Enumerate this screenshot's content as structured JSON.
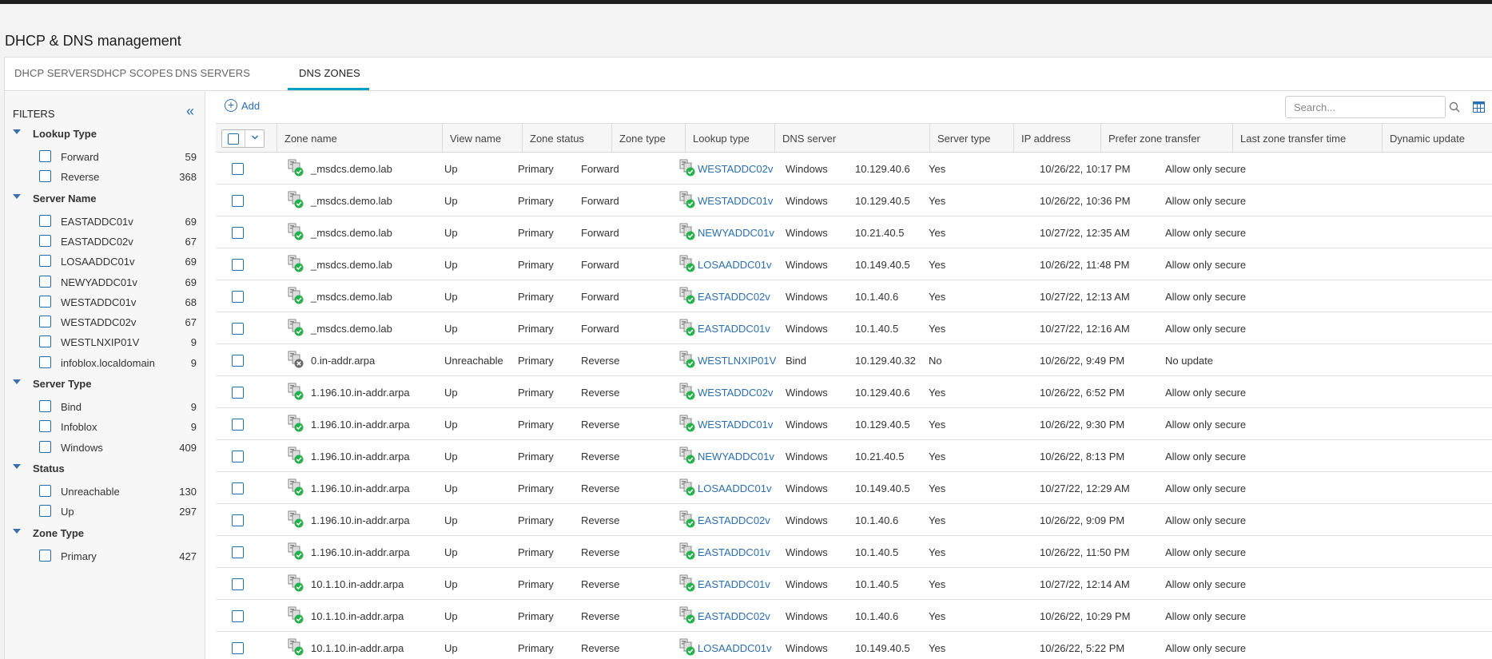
{
  "page": {
    "title": "DHCP & DNS management"
  },
  "tabs": [
    {
      "label": "DHCP SERVERS"
    },
    {
      "label": "DHCP SCOPES"
    },
    {
      "label": "DNS SERVERS"
    },
    {
      "label": "DNS ZONES",
      "active": true
    }
  ],
  "filters": {
    "title": "FILTERS",
    "groups": [
      {
        "label": "Lookup Type",
        "items": [
          {
            "label": "Forward",
            "count": "59"
          },
          {
            "label": "Reverse",
            "count": "368"
          }
        ]
      },
      {
        "label": "Server Name",
        "items": [
          {
            "label": "EASTADDC01v",
            "count": "69"
          },
          {
            "label": "EASTADDC02v",
            "count": "67"
          },
          {
            "label": "LOSAADDC01v",
            "count": "69"
          },
          {
            "label": "NEWYADDC01v",
            "count": "69"
          },
          {
            "label": "WESTADDC01v",
            "count": "68"
          },
          {
            "label": "WESTADDC02v",
            "count": "67"
          },
          {
            "label": "WESTLNXIP01V",
            "count": "9"
          },
          {
            "label": "infoblox.localdomain",
            "count": "9"
          }
        ]
      },
      {
        "label": "Server Type",
        "items": [
          {
            "label": "Bind",
            "count": "9"
          },
          {
            "label": "Infoblox",
            "count": "9"
          },
          {
            "label": "Windows",
            "count": "409"
          }
        ]
      },
      {
        "label": "Status",
        "items": [
          {
            "label": "Unreachable",
            "count": "130"
          },
          {
            "label": "Up",
            "count": "297"
          }
        ]
      },
      {
        "label": "Zone Type",
        "items": [
          {
            "label": "Primary",
            "count": "427"
          }
        ]
      }
    ]
  },
  "toolbar": {
    "add_label": "Add",
    "search_placeholder": "Search..."
  },
  "grid": {
    "columns": [
      {
        "label": "Zone name"
      },
      {
        "label": "View name"
      },
      {
        "label": "Zone status"
      },
      {
        "label": "Zone type"
      },
      {
        "label": "Lookup type"
      },
      {
        "label": "DNS server"
      },
      {
        "label": "Server type"
      },
      {
        "label": "IP address"
      },
      {
        "label": "Prefer zone transfer"
      },
      {
        "label": "Last zone transfer time"
      },
      {
        "label": "Dynamic update"
      }
    ],
    "rows": [
      {
        "zone": "_msdcs.demo.lab",
        "zone_state": "ok",
        "view": "",
        "status": "Up",
        "ztype": "Primary",
        "lookup": "Forward",
        "server": "WESTADDC02v",
        "stype": "Windows",
        "ip": "10.129.40.6",
        "prefer": "Yes",
        "last": "10/26/22, 10:17 PM",
        "dyn": "Allow only secure"
      },
      {
        "zone": "_msdcs.demo.lab",
        "zone_state": "ok",
        "view": "",
        "status": "Up",
        "ztype": "Primary",
        "lookup": "Forward",
        "server": "WESTADDC01v",
        "stype": "Windows",
        "ip": "10.129.40.5",
        "prefer": "Yes",
        "last": "10/26/22, 10:36 PM",
        "dyn": "Allow only secure"
      },
      {
        "zone": "_msdcs.demo.lab",
        "zone_state": "ok",
        "view": "",
        "status": "Up",
        "ztype": "Primary",
        "lookup": "Forward",
        "server": "NEWYADDC01v",
        "stype": "Windows",
        "ip": "10.21.40.5",
        "prefer": "Yes",
        "last": "10/27/22, 12:35 AM",
        "dyn": "Allow only secure"
      },
      {
        "zone": "_msdcs.demo.lab",
        "zone_state": "ok",
        "view": "",
        "status": "Up",
        "ztype": "Primary",
        "lookup": "Forward",
        "server": "LOSAADDC01v",
        "stype": "Windows",
        "ip": "10.149.40.5",
        "prefer": "Yes",
        "last": "10/26/22, 11:48 PM",
        "dyn": "Allow only secure"
      },
      {
        "zone": "_msdcs.demo.lab",
        "zone_state": "ok",
        "view": "",
        "status": "Up",
        "ztype": "Primary",
        "lookup": "Forward",
        "server": "EASTADDC02v",
        "stype": "Windows",
        "ip": "10.1.40.6",
        "prefer": "Yes",
        "last": "10/27/22, 12:13 AM",
        "dyn": "Allow only secure"
      },
      {
        "zone": "_msdcs.demo.lab",
        "zone_state": "ok",
        "view": "",
        "status": "Up",
        "ztype": "Primary",
        "lookup": "Forward",
        "server": "EASTADDC01v",
        "stype": "Windows",
        "ip": "10.1.40.5",
        "prefer": "Yes",
        "last": "10/27/22, 12:16 AM",
        "dyn": "Allow only secure"
      },
      {
        "zone": "0.in-addr.arpa",
        "zone_state": "unreachable",
        "view": "",
        "status": "Unreachable",
        "ztype": "Primary",
        "lookup": "Reverse",
        "server": "WESTLNXIP01V",
        "stype": "Bind",
        "ip": "10.129.40.32",
        "prefer": "No",
        "last": "10/26/22, 9:49 PM",
        "dyn": "No update"
      },
      {
        "zone": "1.196.10.in-addr.arpa",
        "zone_state": "ok",
        "view": "",
        "status": "Up",
        "ztype": "Primary",
        "lookup": "Reverse",
        "server": "WESTADDC02v",
        "stype": "Windows",
        "ip": "10.129.40.6",
        "prefer": "Yes",
        "last": "10/26/22, 6:52 PM",
        "dyn": "Allow only secure"
      },
      {
        "zone": "1.196.10.in-addr.arpa",
        "zone_state": "ok",
        "view": "",
        "status": "Up",
        "ztype": "Primary",
        "lookup": "Reverse",
        "server": "WESTADDC01v",
        "stype": "Windows",
        "ip": "10.129.40.5",
        "prefer": "Yes",
        "last": "10/26/22, 9:30 PM",
        "dyn": "Allow only secure"
      },
      {
        "zone": "1.196.10.in-addr.arpa",
        "zone_state": "ok",
        "view": "",
        "status": "Up",
        "ztype": "Primary",
        "lookup": "Reverse",
        "server": "NEWYADDC01v",
        "stype": "Windows",
        "ip": "10.21.40.5",
        "prefer": "Yes",
        "last": "10/26/22, 8:13 PM",
        "dyn": "Allow only secure"
      },
      {
        "zone": "1.196.10.in-addr.arpa",
        "zone_state": "ok",
        "view": "",
        "status": "Up",
        "ztype": "Primary",
        "lookup": "Reverse",
        "server": "LOSAADDC01v",
        "stype": "Windows",
        "ip": "10.149.40.5",
        "prefer": "Yes",
        "last": "10/27/22, 12:29 AM",
        "dyn": "Allow only secure"
      },
      {
        "zone": "1.196.10.in-addr.arpa",
        "zone_state": "ok",
        "view": "",
        "status": "Up",
        "ztype": "Primary",
        "lookup": "Reverse",
        "server": "EASTADDC02v",
        "stype": "Windows",
        "ip": "10.1.40.6",
        "prefer": "Yes",
        "last": "10/26/22, 9:09 PM",
        "dyn": "Allow only secure"
      },
      {
        "zone": "1.196.10.in-addr.arpa",
        "zone_state": "ok",
        "view": "",
        "status": "Up",
        "ztype": "Primary",
        "lookup": "Reverse",
        "server": "EASTADDC01v",
        "stype": "Windows",
        "ip": "10.1.40.5",
        "prefer": "Yes",
        "last": "10/26/22, 11:50 PM",
        "dyn": "Allow only secure"
      },
      {
        "zone": "10.1.10.in-addr.arpa",
        "zone_state": "ok",
        "view": "",
        "status": "Up",
        "ztype": "Primary",
        "lookup": "Reverse",
        "server": "EASTADDC01v",
        "stype": "Windows",
        "ip": "10.1.40.5",
        "prefer": "Yes",
        "last": "10/27/22, 12:14 AM",
        "dyn": "Allow only secure"
      },
      {
        "zone": "10.1.10.in-addr.arpa",
        "zone_state": "ok",
        "view": "",
        "status": "Up",
        "ztype": "Primary",
        "lookup": "Reverse",
        "server": "EASTADDC02v",
        "stype": "Windows",
        "ip": "10.1.40.6",
        "prefer": "Yes",
        "last": "10/26/22, 10:29 PM",
        "dyn": "Allow only secure"
      },
      {
        "zone": "10.1.10.in-addr.arpa",
        "zone_state": "ok",
        "view": "",
        "status": "Up",
        "ztype": "Primary",
        "lookup": "Reverse",
        "server": "LOSAADDC01v",
        "stype": "Windows",
        "ip": "10.149.40.5",
        "prefer": "Yes",
        "last": "10/26/22, 5:22 PM",
        "dyn": "Allow only secure"
      }
    ]
  },
  "icons": {
    "collapse": "double-chevron-left-icon",
    "add": "plus-circle-icon",
    "search": "search-icon",
    "columns": "columns-icon",
    "zone": "dns-zone-icon",
    "server": "dns-server-icon",
    "status_ok": "green-check-badge",
    "status_unreachable": "grey-x-badge"
  },
  "colors": {
    "accent": "#04a1c2",
    "link": "#2b6fb0",
    "ok": "#27b14a",
    "unreachable": "#6b6b6b"
  }
}
